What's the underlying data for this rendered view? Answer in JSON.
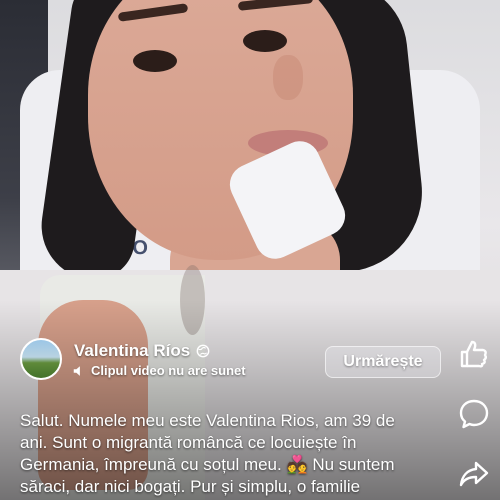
{
  "post": {
    "author_name": "Valentina Ríos",
    "privacy_icon": "globe-icon",
    "sound_notice": "Clipul video nu are sunet",
    "follow_label": "Urmărește"
  },
  "video": {
    "pillow_text": "A.HO"
  },
  "caption": {
    "lines": [
      "Salut. Numele meu este Valentina Rios, am 39 de",
      "ani. Sunt o migrantă româncă ce locuiește în",
      "Germania, împreună cu soțul meu. 💑 Nu suntem",
      "săraci, dar nici bogați. Pur și simplu, o familie"
    ]
  },
  "actions": [
    "like-icon",
    "comment-icon",
    "share-icon"
  ]
}
